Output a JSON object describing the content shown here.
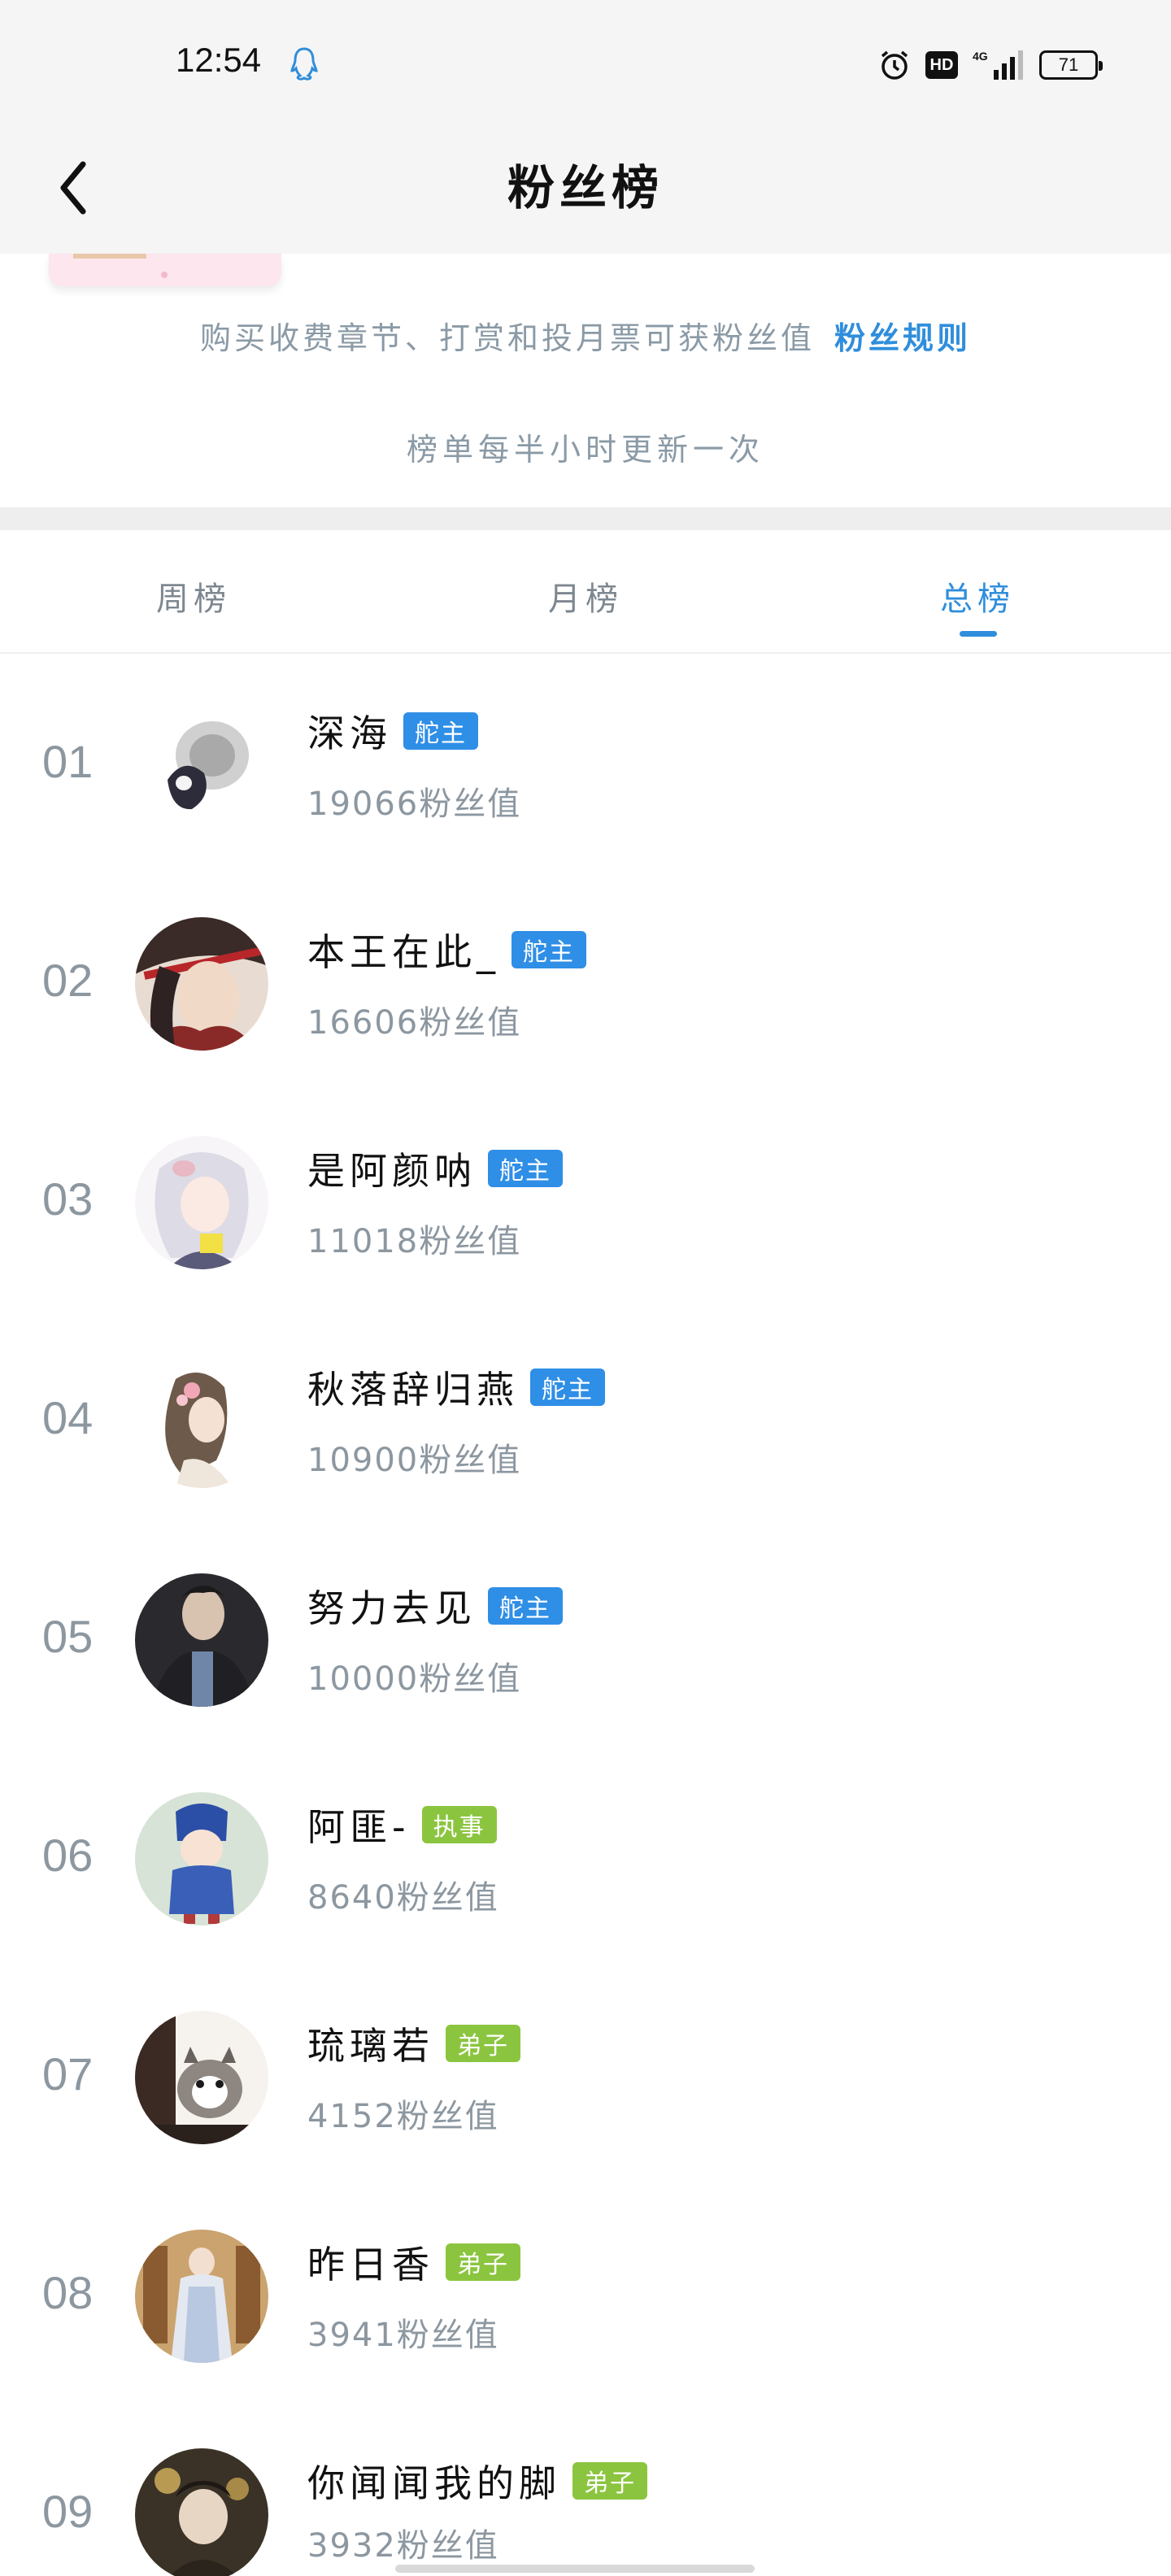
{
  "status_bar": {
    "time": "12:54",
    "battery": "71",
    "hd_label": "HD",
    "network_label": "4G"
  },
  "nav": {
    "title": "粉丝榜"
  },
  "info": {
    "rules_text": "购买收费章节、打赏和投月票可获粉丝值",
    "rules_link": "粉丝规则",
    "update_note": "榜单每半小时更新一次"
  },
  "tabs": [
    {
      "label": "周榜",
      "active": false
    },
    {
      "label": "月榜",
      "active": false
    },
    {
      "label": "总榜",
      "active": true
    }
  ],
  "ranking": [
    {
      "rank": "01",
      "name": "深海",
      "badge": "舵主",
      "badge_color": "#2f8ee6",
      "fans": "19066粉丝值"
    },
    {
      "rank": "02",
      "name": "本王在此_",
      "badge": "舵主",
      "badge_color": "#2f8ee6",
      "fans": "16606粉丝值"
    },
    {
      "rank": "03",
      "name": "是阿颜呐",
      "badge": "舵主",
      "badge_color": "#2f8ee6",
      "fans": "11018粉丝值"
    },
    {
      "rank": "04",
      "name": "秋落辞归燕",
      "badge": "舵主",
      "badge_color": "#2f8ee6",
      "fans": "10900粉丝值"
    },
    {
      "rank": "05",
      "name": "努力去见",
      "badge": "舵主",
      "badge_color": "#2f8ee6",
      "fans": "10000粉丝值"
    },
    {
      "rank": "06",
      "name": "阿匪-",
      "badge": "执事",
      "badge_color": "#8bc53f",
      "fans": "8640粉丝值"
    },
    {
      "rank": "07",
      "name": "琉璃若",
      "badge": "弟子",
      "badge_color": "#8bc53f",
      "fans": "4152粉丝值"
    },
    {
      "rank": "08",
      "name": "昨日香",
      "badge": "弟子",
      "badge_color": "#8bc53f",
      "fans": "3941粉丝值"
    },
    {
      "rank": "09",
      "name": "你闻闻我的脚",
      "badge": "弟子",
      "badge_color": "#8bc53f",
      "fans": "3932粉丝值"
    }
  ],
  "colors": {
    "accent": "#2f8edc",
    "badge_blue": "#2f8ee6",
    "badge_green": "#8bc53f"
  }
}
